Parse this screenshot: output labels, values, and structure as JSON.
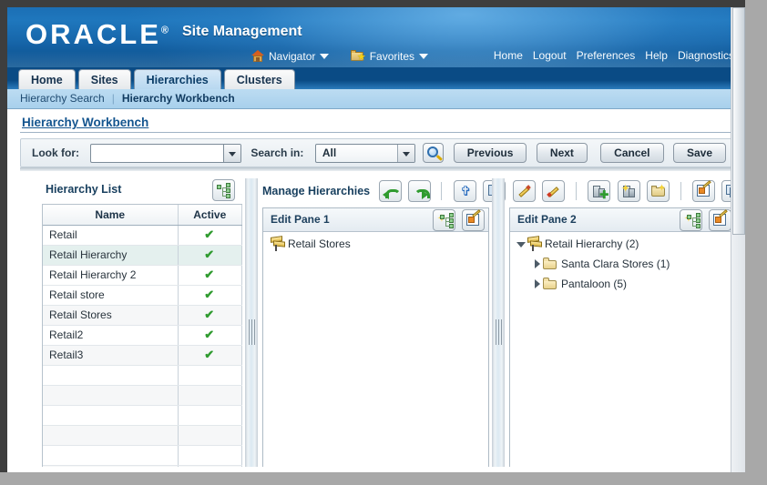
{
  "brand": {
    "name": "ORACLE",
    "registered": "®"
  },
  "header": {
    "app_title": "Site Management",
    "nav": [
      {
        "label": "Navigator",
        "icon": "home-icon"
      },
      {
        "label": "Favorites",
        "icon": "favorites-folder-star-icon"
      }
    ],
    "global_links": [
      "Home",
      "Logout",
      "Preferences",
      "Help",
      "Diagnostics"
    ]
  },
  "tabs": [
    {
      "label": "Home",
      "active": false
    },
    {
      "label": "Sites",
      "active": false
    },
    {
      "label": "Hierarchies",
      "active": true
    },
    {
      "label": "Clusters",
      "active": false
    }
  ],
  "subnav": {
    "items": [
      "Hierarchy Search",
      "Hierarchy Workbench"
    ],
    "current": "Hierarchy Workbench",
    "separator": "|"
  },
  "page": {
    "title": "Hierarchy Workbench"
  },
  "actionbar": {
    "look_for_label": "Look for:",
    "look_for_value": "",
    "look_for_placeholder": "",
    "search_in_label": "Search in:",
    "search_in_value": "All",
    "search_in_options": [
      "All"
    ],
    "search_icon": "search-magnifier-icon",
    "previous_label": "Previous",
    "next_label": "Next",
    "cancel_label": "Cancel",
    "save_label": "Save"
  },
  "hierarchy_list": {
    "title": "Hierarchy List",
    "add_icon": "hierarchy-add-icon",
    "columns": [
      "Name",
      "Active"
    ],
    "rows": [
      {
        "name": "Retail",
        "active": "✔",
        "selected": false
      },
      {
        "name": "Retail Hierarchy",
        "active": "✔",
        "selected": true
      },
      {
        "name": "Retail Hierarchy 2",
        "active": "✔",
        "selected": false
      },
      {
        "name": "Retail store",
        "active": "✔",
        "selected": false
      },
      {
        "name": "Retail Stores",
        "active": "✔",
        "selected": false
      },
      {
        "name": "Retail2",
        "active": "✔",
        "selected": false
      },
      {
        "name": "Retail3",
        "active": "✔",
        "selected": false
      },
      {
        "name": "",
        "active": "",
        "selected": false
      },
      {
        "name": "",
        "active": "",
        "selected": false
      },
      {
        "name": "",
        "active": "",
        "selected": false
      },
      {
        "name": "",
        "active": "",
        "selected": false
      },
      {
        "name": "",
        "active": "",
        "selected": false
      },
      {
        "name": "",
        "active": "",
        "selected": false
      }
    ]
  },
  "manage_hierarchies": {
    "title": "Manage Hierarchies",
    "toolbar": [
      {
        "name": "undo-button",
        "icon": "undo-green-arrow-icon"
      },
      {
        "name": "redo-button",
        "icon": "redo-green-arrow-icon"
      },
      {
        "name": "move-button",
        "icon": "move-four-arrows-icon"
      },
      {
        "name": "copy-button",
        "icon": "copy-documents-icon"
      },
      {
        "name": "edit-button",
        "icon": "pencil-edit-icon"
      },
      {
        "name": "rename-button",
        "icon": "pencil-rename-icon"
      },
      {
        "name": "add-site-button",
        "icon": "building-add-icon"
      },
      {
        "name": "new-site-button",
        "icon": "building-new-icon"
      },
      {
        "name": "new-folder-button",
        "icon": "folder-new-icon"
      },
      {
        "name": "edit-properties-button",
        "icon": "properties-edit-icon"
      },
      {
        "name": "delete-button",
        "icon": "delete-stack-icon"
      }
    ]
  },
  "edit_pane_1": {
    "title": "Edit Pane 1",
    "tools": [
      {
        "name": "tree-view-button",
        "icon": "tree-structure-icon"
      },
      {
        "name": "pane-properties-button",
        "icon": "properties-edit-icon"
      }
    ],
    "tree": [
      {
        "label": "Retail Stores",
        "icon": "signpost-hierarchy-icon",
        "indent": 0,
        "twist": "none"
      }
    ]
  },
  "edit_pane_2": {
    "title": "Edit Pane 2",
    "tools": [
      {
        "name": "tree-view-button",
        "icon": "tree-structure-icon"
      },
      {
        "name": "pane-properties-button",
        "icon": "properties-edit-icon"
      }
    ],
    "tree": [
      {
        "label": "Retail Hierarchy (2)",
        "icon": "signpost-hierarchy-icon",
        "indent": 0,
        "twist": "open"
      },
      {
        "label": "Santa Clara Stores (1)",
        "icon": "folder-icon",
        "indent": 1,
        "twist": "closed"
      },
      {
        "label": "Pantaloon (5)",
        "icon": "folder-icon",
        "indent": 1,
        "twist": "closed"
      }
    ]
  },
  "colors": {
    "brand_blue": "#1f77bd",
    "dark_blue": "#0a4b85",
    "active_tab": "#b8d8f0",
    "link_blue": "#14558f",
    "check_green": "#2f9b2f",
    "selected_row": "#e4f0ee"
  }
}
